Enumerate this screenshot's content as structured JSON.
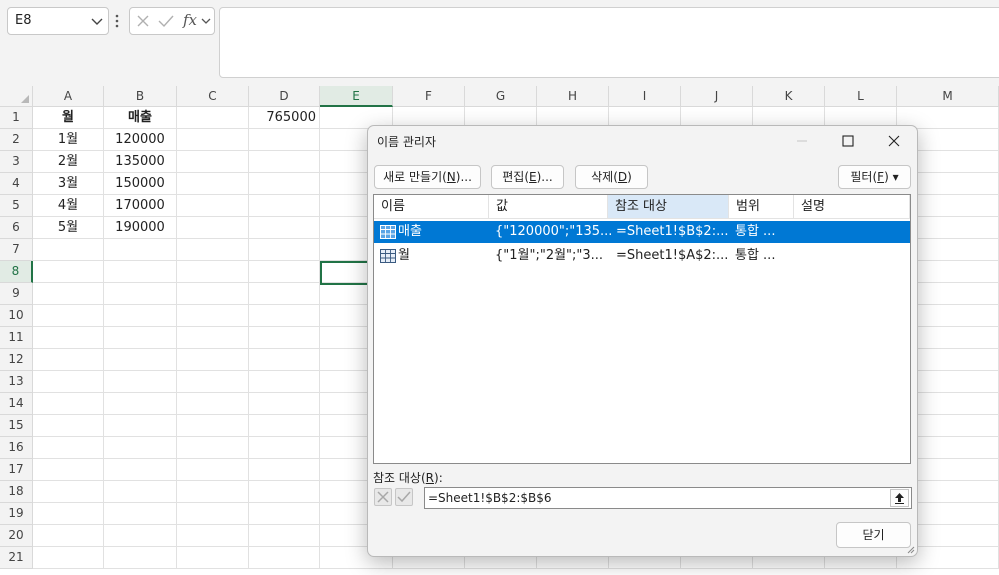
{
  "formula_bar": {
    "name_box": "E8",
    "fx": "fx",
    "formula": ""
  },
  "grid": {
    "columns": [
      "A",
      "B",
      "C",
      "D",
      "E",
      "F",
      "G",
      "H",
      "I",
      "J",
      "K",
      "L",
      "M"
    ],
    "rows": [
      "1",
      "2",
      "3",
      "4",
      "5",
      "6",
      "7",
      "8",
      "9",
      "10",
      "11",
      "12",
      "13",
      "14",
      "15",
      "16",
      "17",
      "18",
      "19",
      "20",
      "21"
    ],
    "selected_column": "E",
    "selected_row": "8",
    "cells": {
      "A1": "월",
      "B1": "매출",
      "D1": "765000",
      "A2": "1월",
      "B2": "120000",
      "A3": "2월",
      "B3": "135000",
      "A4": "3월",
      "B4": "150000",
      "A5": "4월",
      "B5": "170000",
      "A6": "5월",
      "B6": "190000"
    }
  },
  "dialog": {
    "title": "이름 관리자",
    "buttons": {
      "new_label": "새로 만들기",
      "new_key": "N",
      "edit_label": "편집",
      "edit_key": "E",
      "delete_label": "삭제",
      "delete_key": "D",
      "filter_label": "필터",
      "filter_key": "F",
      "close": "닫기"
    },
    "list": {
      "headers": [
        "이름",
        "값",
        "참조 대상",
        "범위",
        "설명"
      ],
      "rows": [
        {
          "name": "매출",
          "value": "{\"120000\";\"135...",
          "refers_to": "=Sheet1!$B$2:...",
          "scope": "통합 ...",
          "comment": ""
        },
        {
          "name": "월",
          "value": "{\"1월\";\"2월\";\"3...",
          "refers_to": "=Sheet1!$A$2:...",
          "scope": "통합 ...",
          "comment": ""
        }
      ],
      "selected_index": 0
    },
    "refers_to_label": "참조 대상",
    "refers_to_key": "R",
    "refers_to_value": "=Sheet1!$B$2:$B$6"
  },
  "colors": {
    "excel_green": "#217346",
    "selection_blue": "#0078d4",
    "sorted_header": "#d9e8f7"
  }
}
